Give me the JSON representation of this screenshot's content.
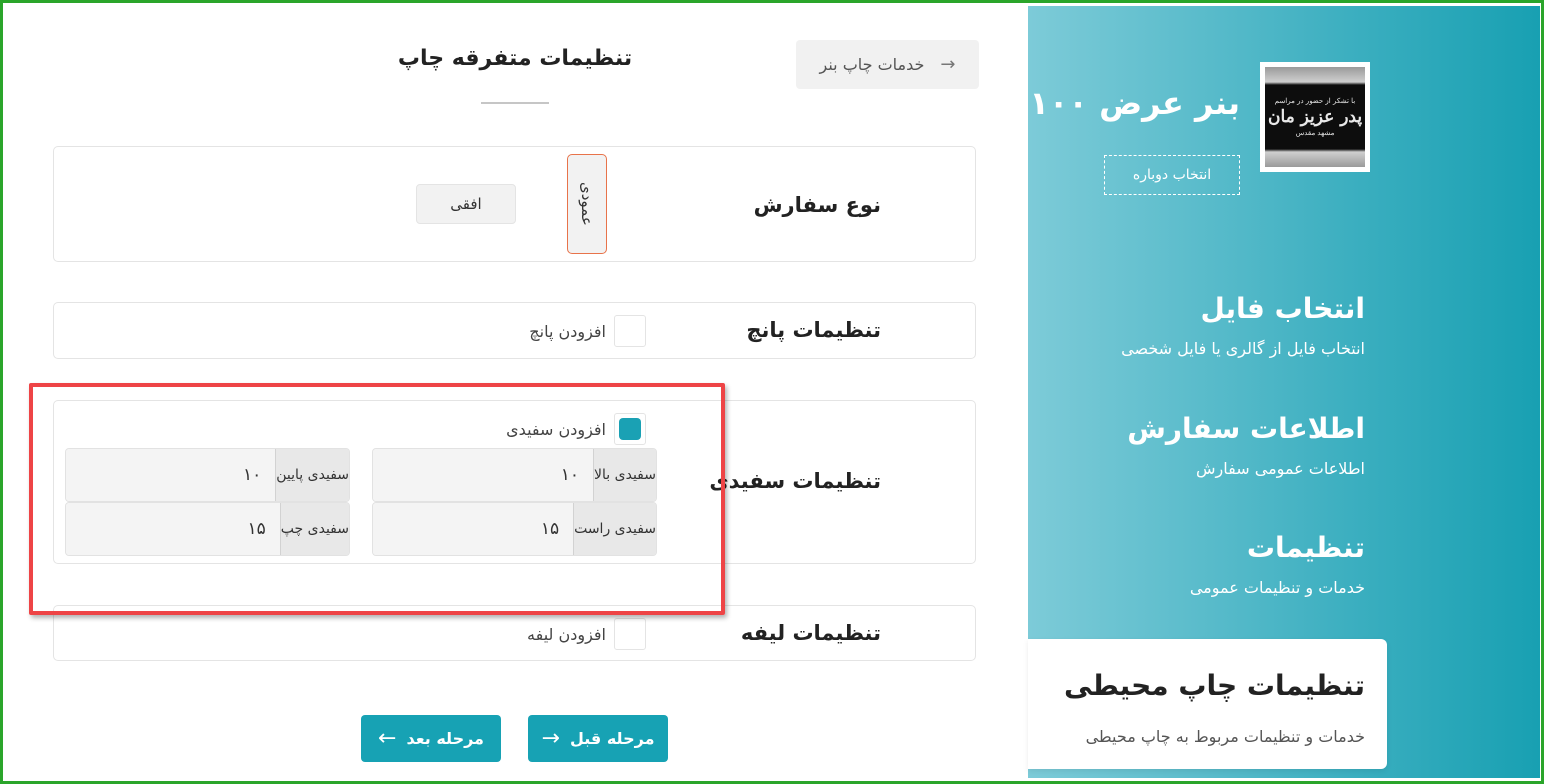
{
  "sidebar": {
    "product_title": "بنر عرض ۱۰۰",
    "thumb_lines": [
      "با تشکر از حضور در مراسم",
      "پدر عزیز مان",
      "مشهد مقدس"
    ],
    "reselect_label": "انتخاب دوباره",
    "steps": [
      {
        "title": "انتخاب فایل",
        "desc": "انتخاب فایل از گالری یا فایل شخصی"
      },
      {
        "title": "اطلاعات سفارش",
        "desc": "اطلاعات عمومی سفارش"
      },
      {
        "title": "تنظیمات",
        "desc": "خدمات و تنظیمات عمومی"
      },
      {
        "title": "تنظیمات چاپ محیطی",
        "desc": "خدمات و تنظیمات مربوط به چاپ محیطی"
      }
    ],
    "colors": {
      "gradient_start": "#7dcbd8",
      "gradient_end": "#18a0b2"
    }
  },
  "header": {
    "back_label": "خدمات چاپ بنر",
    "back_icon": "arrow-right-icon",
    "page_title": "تنظیمات متفرقه چاپ"
  },
  "order_type": {
    "label": "نوع سفارش",
    "vertical_label": "عمودی",
    "horizontal_label": "افقی",
    "selected": "عمودی"
  },
  "punch": {
    "label": "تنظیمات پانچ",
    "checkbox_label": "افزودن پانچ",
    "checked": false
  },
  "whitespace": {
    "label": "تنظیمات سفیدی",
    "checkbox_label": "افزودن سفیدی",
    "checked": true,
    "top_label": "سفیدی بالا",
    "top_value": "۱۰",
    "bottom_label": "سفیدی پایین",
    "bottom_value": "۱۰",
    "right_label": "سفیدی راست",
    "right_value": "۱۵",
    "left_label": "سفیدی چپ",
    "left_value": "۱۵"
  },
  "leaf": {
    "label": "تنظیمات لیفه",
    "checkbox_label": "افزودن لیفه",
    "checked": false
  },
  "nav": {
    "prev_label": "مرحله قبل",
    "next_label": "مرحله بعد"
  },
  "colors": {
    "accent": "#17a2b4",
    "highlight_border": "#ee4446",
    "selected_border": "#e8734a",
    "frame": "#2aa52a"
  }
}
